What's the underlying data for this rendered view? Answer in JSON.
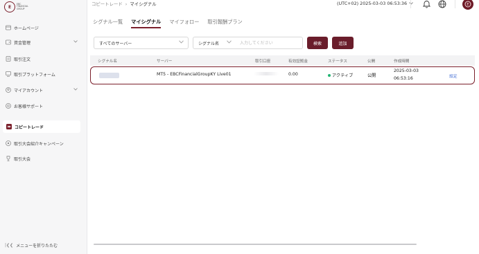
{
  "app": {
    "logo_text_lines": [
      "EBC",
      "FINANCIAL",
      "GROUP"
    ],
    "brand_color": "#7a1f2b"
  },
  "sidebar": {
    "items": [
      {
        "label": "ホームページ",
        "icon": "home-icon"
      },
      {
        "label": "資金管理",
        "icon": "wallet-icon",
        "has_submenu": true
      },
      {
        "label": "取引注文",
        "icon": "order-icon"
      },
      {
        "label": "取引プラットフォーム",
        "icon": "platform-icon"
      },
      {
        "label": "マイアカウント",
        "icon": "user-icon",
        "has_submenu": true
      },
      {
        "label": "お客様サポート",
        "icon": "support-icon"
      },
      {
        "label": "コピートレード",
        "icon": "copytrade-icon",
        "active": true
      },
      {
        "label": "取引大会紹介キャンペーン",
        "icon": "referral-icon"
      },
      {
        "label": "取引大会",
        "icon": "trophy-icon"
      }
    ],
    "collapse_label": "メニューを折りたたむ"
  },
  "header": {
    "breadcrumb": [
      "コピートレード",
      "マイシグナル"
    ],
    "timezone": "(UTC+02)  2025-03-03 06:53:36"
  },
  "tabs": [
    {
      "label": "シグナル一覧",
      "active": false
    },
    {
      "label": "マイシグナル",
      "active": true
    },
    {
      "label": "マイフォロー",
      "active": false
    },
    {
      "label": "取引報酬プラン",
      "active": false
    }
  ],
  "filters": {
    "server_select": "すべてのサーバー",
    "field_select": "シグナル名",
    "search_placeholder": "入力してください",
    "search_button": "検索",
    "add_button": "追加"
  },
  "table": {
    "columns": [
      "シグナル名",
      "サーバー",
      "取引口座",
      "有効証拠金",
      "ステータス",
      "公開",
      "作成時間"
    ],
    "rows": [
      {
        "server": "MT5 - EBCFinancialGroupKY Live01",
        "equity": "0.00",
        "status": "アクティブ",
        "public": "公開",
        "created_date": "2025-03-03",
        "created_time": "06:53:16",
        "action": "設定"
      }
    ]
  }
}
